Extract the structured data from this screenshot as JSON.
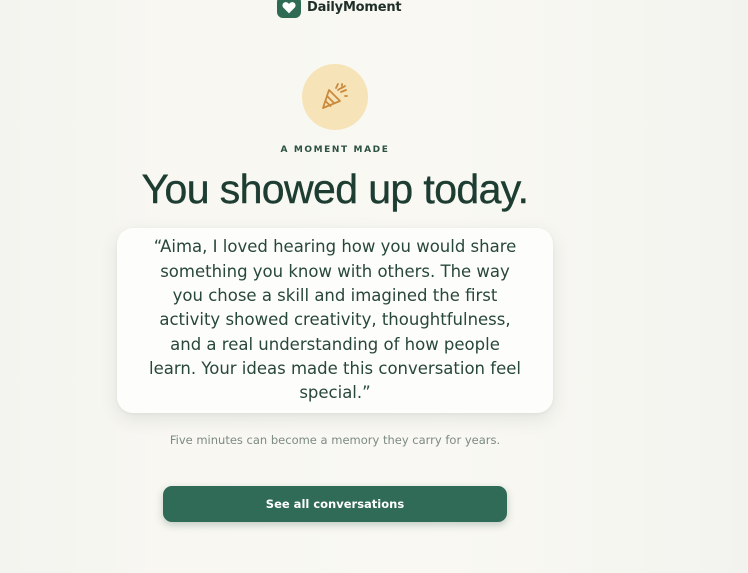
{
  "brand": {
    "name": "DailyMoment",
    "icon": "heart-icon"
  },
  "celebration": {
    "icon": "party-popper-icon",
    "eyebrow": "A MOMENT MADE",
    "headline": "You showed up today."
  },
  "quote": {
    "text": "“Aima, I loved hearing how you would share something you know with others. The way you chose a skill and imagined the first activity showed creativity, thoughtfulness, and a real understanding of how people learn. Your ideas made this conversation feel special.”"
  },
  "subtext": "Five minutes can become a memory they carry for years.",
  "cta": {
    "label": "See all conversations"
  },
  "colors": {
    "accent": "#2f6b57",
    "badge_bg": "#f7e3b8",
    "badge_icon": "#c98a3c",
    "heading": "#1e3d32"
  }
}
